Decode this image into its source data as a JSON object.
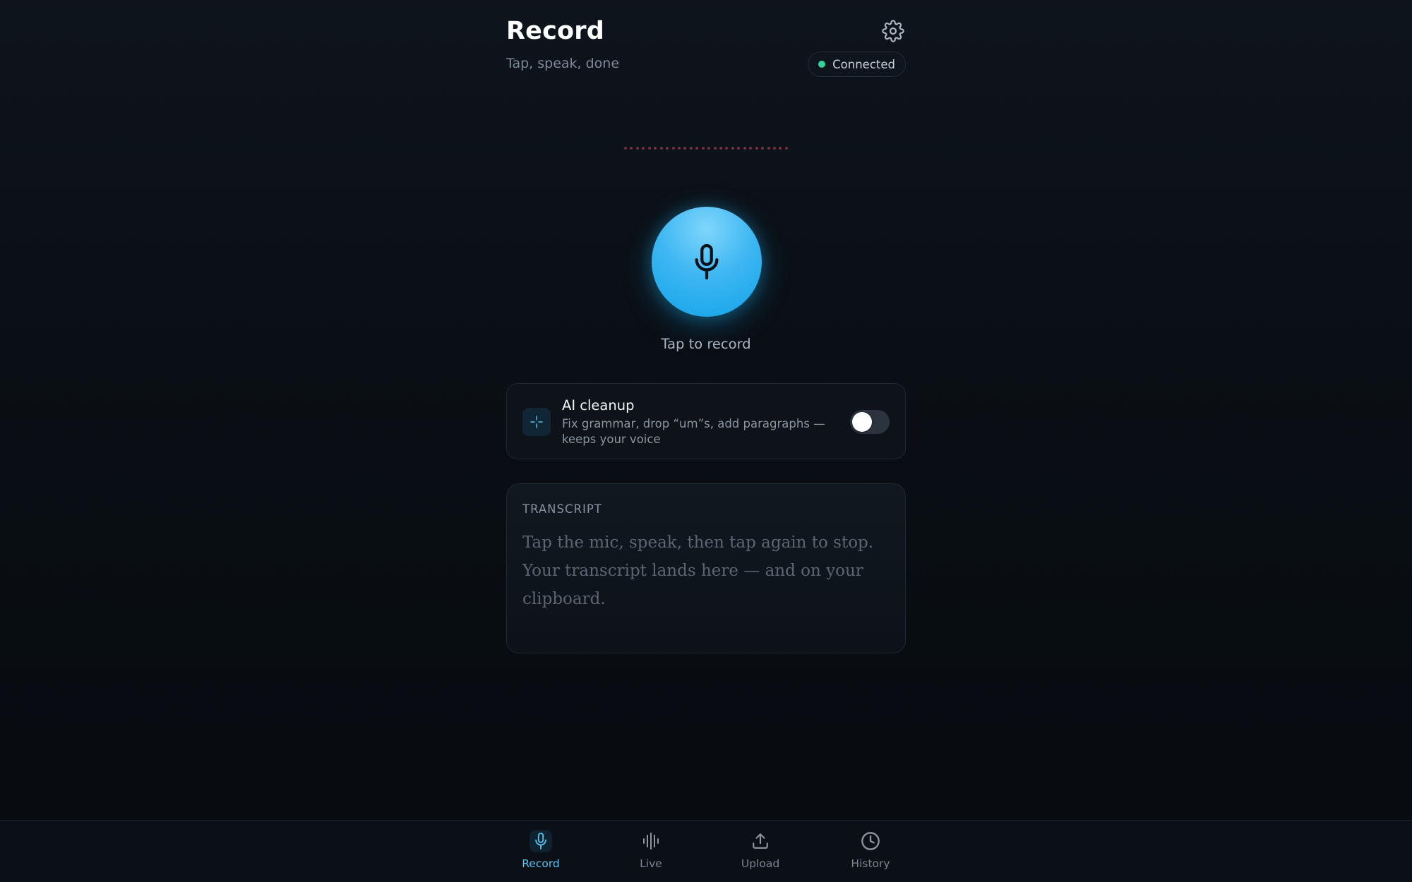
{
  "header": {
    "title": "Record",
    "subtitle": "Tap, speak, done",
    "status_text": "Connected",
    "status_color": "#34d399"
  },
  "icons": {
    "settings": "gear-icon",
    "mic": "microphone-icon",
    "cleanup": "sparkle-icon"
  },
  "waveform": {
    "dot_count": 28,
    "color": "#7a2e3c"
  },
  "record": {
    "tap_label": "Tap to record",
    "accent": "#38bdf8"
  },
  "ai_cleanup": {
    "title": "AI cleanup",
    "description": "Fix grammar, drop “um”s, add paragraphs — keeps your voice",
    "enabled": false
  },
  "transcript": {
    "label": "TRANSCRIPT",
    "placeholder": "Tap the mic, speak, then tap again to stop. Your transcript lands here — and on your clipboard."
  },
  "nav": {
    "items": [
      {
        "label": "Record",
        "icon": "microphone-icon",
        "active": true
      },
      {
        "label": "Live",
        "icon": "waveform-icon",
        "active": false
      },
      {
        "label": "Upload",
        "icon": "upload-icon",
        "active": false
      },
      {
        "label": "History",
        "icon": "clock-icon",
        "active": false
      }
    ]
  }
}
